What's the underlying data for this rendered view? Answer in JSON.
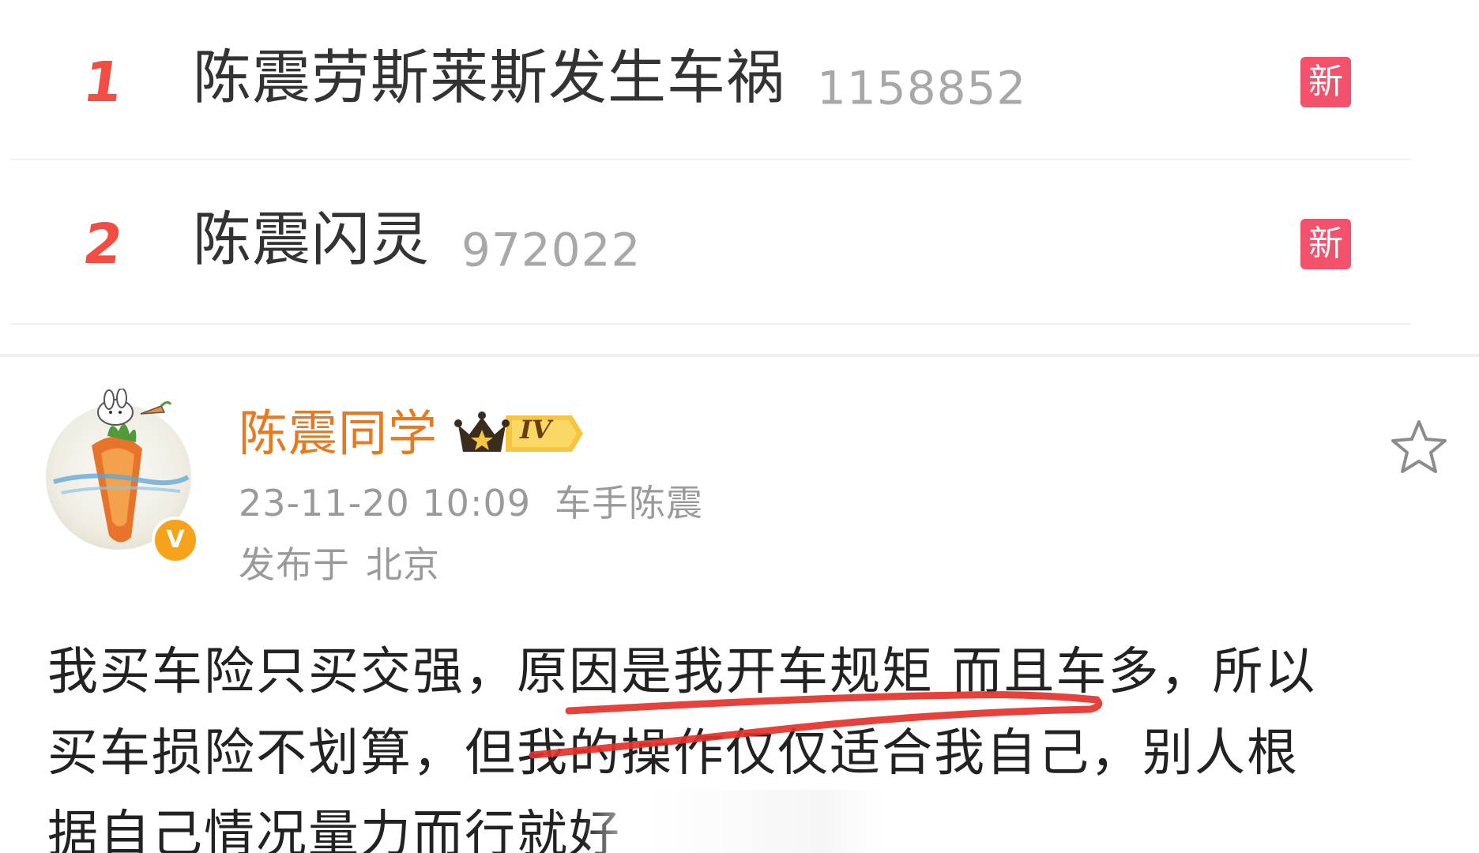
{
  "hot_search": {
    "items": [
      {
        "rank": "1",
        "title": "陈震劳斯莱斯发生车祸",
        "count": "1158852",
        "badge": "新"
      },
      {
        "rank": "2",
        "title": "陈震闪灵",
        "count": "972022",
        "badge": "新"
      }
    ]
  },
  "post": {
    "username": "陈震同学",
    "level": "IV",
    "verified_mark": "V",
    "timestamp": "23-11-20 10:09",
    "source": "车手陈震",
    "location_label": "发布于",
    "location": "北京",
    "body_lines": [
      "我买车险只买交强，原因是我开车规矩 而且车多，所以",
      "买车损险不划算，但我的操作仅仅适合我自己，别人根",
      "据自己情况量力而行就好"
    ]
  },
  "colors": {
    "rank": "#f24c43",
    "new_badge": "#f4516c",
    "username": "#e57a22",
    "muted": "#9a9a9a",
    "underline": "#e5312b",
    "verified": "#f6a21b"
  },
  "icons": {
    "favorite": "star-outline-icon",
    "level": "crown-icon",
    "verified": "verified-v-icon"
  }
}
